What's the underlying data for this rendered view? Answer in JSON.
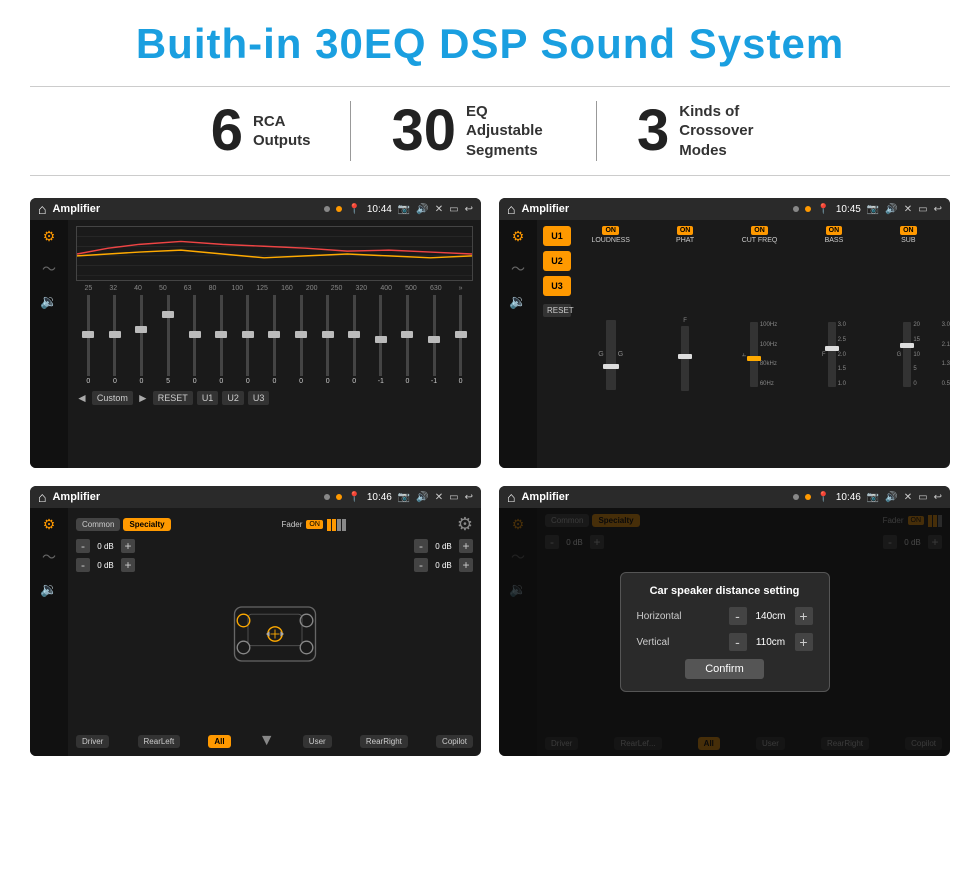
{
  "title": "Buith-in 30EQ DSP Sound System",
  "stats": [
    {
      "number": "6",
      "label": "RCA\nOutputs"
    },
    {
      "number": "30",
      "label": "EQ Adjustable\nSegments"
    },
    {
      "number": "3",
      "label": "Kinds of\nCrossover Modes"
    }
  ],
  "screens": [
    {
      "id": "screen1",
      "time": "10:44",
      "title": "Amplifier",
      "type": "eq",
      "eq_freqs": [
        "25",
        "32",
        "40",
        "50",
        "63",
        "80",
        "100",
        "125",
        "160",
        "200",
        "250",
        "320",
        "400",
        "500",
        "630"
      ],
      "eq_values": [
        "0",
        "0",
        "0",
        "5",
        "0",
        "0",
        "0",
        "0",
        "0",
        "0",
        "0",
        "-1",
        "0",
        "-1"
      ],
      "preset": "Custom",
      "buttons": [
        "RESET",
        "U1",
        "U2",
        "U3"
      ]
    },
    {
      "id": "screen2",
      "time": "10:45",
      "title": "Amplifier",
      "type": "amp2",
      "presets": [
        "U1",
        "U2",
        "U3"
      ],
      "sections": [
        {
          "label": "LOUDNESS",
          "on": true
        },
        {
          "label": "PHAT",
          "on": true
        },
        {
          "label": "CUT FREQ",
          "on": true
        },
        {
          "label": "BASS",
          "on": true
        },
        {
          "label": "SUB",
          "on": true
        }
      ]
    },
    {
      "id": "screen3",
      "time": "10:46",
      "title": "Amplifier",
      "type": "crossover",
      "modes": [
        "Common",
        "Specialty"
      ],
      "active_mode": "Specialty",
      "fader": "ON",
      "volumes_left": [
        "0 dB",
        "0 dB"
      ],
      "volumes_right": [
        "0 dB",
        "0 dB"
      ],
      "nav_btns": [
        "Driver",
        "RearLeft",
        "All",
        "User",
        "RearRight",
        "Copilot"
      ]
    },
    {
      "id": "screen4",
      "time": "10:46",
      "title": "Amplifier",
      "type": "dialog",
      "dialog_title": "Car speaker distance setting",
      "fields": [
        {
          "label": "Horizontal",
          "value": "140cm"
        },
        {
          "label": "Vertical",
          "value": "110cm"
        }
      ],
      "confirm_label": "Confirm"
    }
  ]
}
